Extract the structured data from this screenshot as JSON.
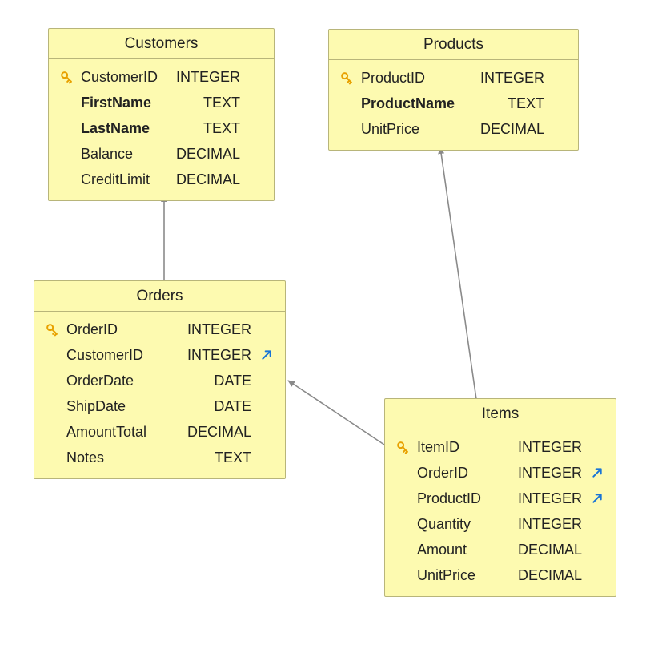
{
  "entities": {
    "customers": {
      "title": "Customers",
      "rows": [
        {
          "name": "CustomerID",
          "type": "INTEGER",
          "pk": true,
          "fk": false,
          "bold": false
        },
        {
          "name": "FirstName",
          "type": "TEXT",
          "pk": false,
          "fk": false,
          "bold": true
        },
        {
          "name": "LastName",
          "type": "TEXT",
          "pk": false,
          "fk": false,
          "bold": true
        },
        {
          "name": "Balance",
          "type": "DECIMAL",
          "pk": false,
          "fk": false,
          "bold": false
        },
        {
          "name": "CreditLimit",
          "type": "DECIMAL",
          "pk": false,
          "fk": false,
          "bold": false
        }
      ]
    },
    "products": {
      "title": "Products",
      "rows": [
        {
          "name": "ProductID",
          "type": "INTEGER",
          "pk": true,
          "fk": false,
          "bold": false
        },
        {
          "name": "ProductName",
          "type": "TEXT",
          "pk": false,
          "fk": false,
          "bold": true
        },
        {
          "name": "UnitPrice",
          "type": "DECIMAL",
          "pk": false,
          "fk": false,
          "bold": false
        }
      ]
    },
    "orders": {
      "title": "Orders",
      "rows": [
        {
          "name": "OrderID",
          "type": "INTEGER",
          "pk": true,
          "fk": false,
          "bold": false
        },
        {
          "name": "CustomerID",
          "type": "INTEGER",
          "pk": false,
          "fk": true,
          "bold": false
        },
        {
          "name": "OrderDate",
          "type": "DATE",
          "pk": false,
          "fk": false,
          "bold": false
        },
        {
          "name": "ShipDate",
          "type": "DATE",
          "pk": false,
          "fk": false,
          "bold": false
        },
        {
          "name": "AmountTotal",
          "type": "DECIMAL",
          "pk": false,
          "fk": false,
          "bold": false
        },
        {
          "name": "Notes",
          "type": "TEXT",
          "pk": false,
          "fk": false,
          "bold": false
        }
      ]
    },
    "items": {
      "title": "Items",
      "rows": [
        {
          "name": "ItemID",
          "type": "INTEGER",
          "pk": true,
          "fk": false,
          "bold": false
        },
        {
          "name": "OrderID",
          "type": "INTEGER",
          "pk": false,
          "fk": true,
          "bold": false
        },
        {
          "name": "ProductID",
          "type": "INTEGER",
          "pk": false,
          "fk": true,
          "bold": false
        },
        {
          "name": "Quantity",
          "type": "INTEGER",
          "pk": false,
          "fk": false,
          "bold": false
        },
        {
          "name": "Amount",
          "type": "DECIMAL",
          "pk": false,
          "fk": false,
          "bold": false
        },
        {
          "name": "UnitPrice",
          "type": "DECIMAL",
          "pk": false,
          "fk": false,
          "bold": false
        }
      ]
    }
  },
  "chart_data": {
    "type": "table",
    "erd": true,
    "entities": [
      "Customers",
      "Products",
      "Orders",
      "Items"
    ],
    "relationships": [
      {
        "from": "Orders.CustomerID",
        "to": "Customers.CustomerID"
      },
      {
        "from": "Items.OrderID",
        "to": "Orders.OrderID"
      },
      {
        "from": "Items.ProductID",
        "to": "Products.ProductID"
      }
    ]
  }
}
